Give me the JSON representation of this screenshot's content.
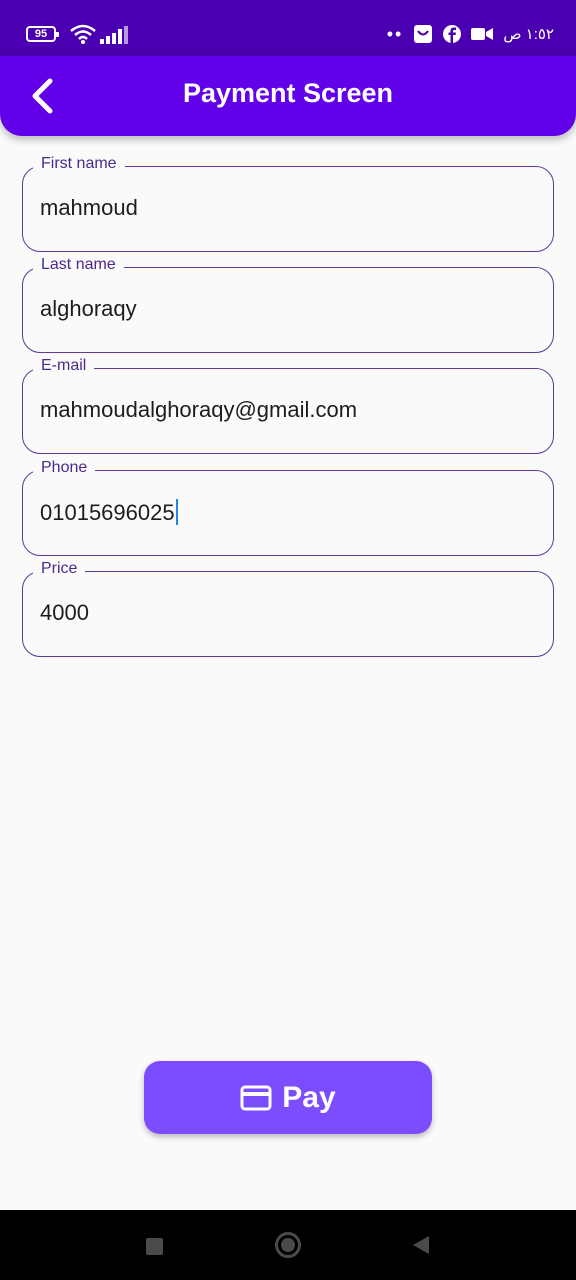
{
  "status_bar": {
    "battery": "95",
    "time": "١:٥٢ ص",
    "icons": [
      "wifi-icon",
      "signal-icon",
      "dots-icon",
      "mail-badge-icon",
      "facebook-icon",
      "video-camera-icon"
    ]
  },
  "app_bar": {
    "title": "Payment Screen",
    "back_icon": "chevron-left-icon"
  },
  "form": {
    "first_name": {
      "label": "First name",
      "value": "mahmoud"
    },
    "last_name": {
      "label": "Last name",
      "value": "alghoraqy"
    },
    "email": {
      "label": "E-mail",
      "value": "mahmoudalghoraqy@gmail.com"
    },
    "phone": {
      "label": "Phone",
      "value": "01015696025"
    },
    "price": {
      "label": "Price",
      "value": "4000"
    }
  },
  "pay_button": {
    "label": "Pay",
    "icon": "credit-card-icon"
  },
  "nav_bar": {
    "icons": [
      "recents-icon",
      "home-icon",
      "back-icon"
    ]
  },
  "colors": {
    "status_bar": "#4a00b0",
    "app_bar": "#6200ea",
    "field_border": "#5b3a9c",
    "pay_button": "#7c4dff",
    "caret": "#1e88e5"
  }
}
